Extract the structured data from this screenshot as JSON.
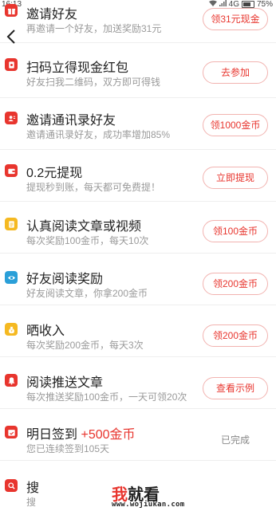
{
  "status_bar": {
    "time": "16:13",
    "network": "4G",
    "battery": "75%"
  },
  "colors": {
    "accent": "#e8352e",
    "icon_red": "#e8352e",
    "icon_yellow": "#f5b921",
    "icon_teal": "#2a9fd8"
  },
  "rows": [
    {
      "title": "邀请好友",
      "subtitle": "再邀请一个好友，加送奖励31元",
      "button": "领31元现金",
      "icon": "gift-icon",
      "icon_color": "#e8352e"
    },
    {
      "title": "扫码立得现金红包",
      "subtitle": "好友扫我二维码，双方即可得钱",
      "button": "去参加",
      "icon": "red-packet-icon",
      "icon_color": "#e8352e"
    },
    {
      "title": "邀请通讯录好友",
      "subtitle": "邀请通讯录好友，成功率增加85%",
      "button": "领1000金币",
      "icon": "contacts-icon",
      "icon_color": "#e8352e"
    },
    {
      "title": "0.2元提现",
      "subtitle": "提现秒到账，每天都可免费提！",
      "button": "立即提现",
      "icon": "wallet-icon",
      "icon_color": "#e8352e"
    },
    {
      "title": "认真阅读文章或视频",
      "subtitle": "每次奖励100金币，每天10次",
      "button": "领100金币",
      "icon": "document-icon",
      "icon_color": "#f5b921"
    },
    {
      "title": "好友阅读奖励",
      "subtitle": "好友阅读文章，你拿200金币",
      "button": "领200金币",
      "icon": "eye-icon",
      "icon_color": "#2a9fd8"
    },
    {
      "title": "晒收入",
      "subtitle": "每次奖励200金币，每天3次",
      "button": "领200金币",
      "icon": "money-bag-icon",
      "icon_color": "#f5b921"
    },
    {
      "title": "阅读推送文章",
      "subtitle": "每次推送奖励100金币，一天可领20次",
      "button": "查看示例",
      "icon": "bell-icon",
      "icon_color": "#e8352e"
    },
    {
      "title": "明日签到",
      "title_highlight": "+500金币",
      "subtitle": "您已连续签到105天",
      "status": "已完成",
      "icon": "calendar-icon",
      "icon_color": "#e8352e"
    },
    {
      "title": "搜",
      "subtitle": "搜",
      "icon": "search-icon",
      "icon_color": "#e8352e"
    }
  ],
  "watermark": {
    "text_red": "我",
    "text_dark": "就看",
    "url": "www.wojiukan.com"
  }
}
